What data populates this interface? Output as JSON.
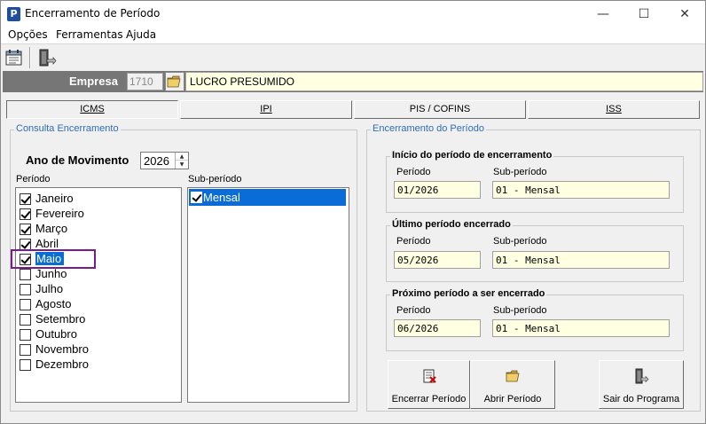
{
  "window": {
    "title": "Encerramento de Período",
    "icon_letter": "P",
    "minimize_glyph": "—",
    "maximize_glyph": "☐",
    "close_glyph": "✕"
  },
  "menu": [
    "Opções",
    "Ferramentas",
    "Ajuda"
  ],
  "empresa": {
    "label": "Empresa",
    "code": "1710",
    "name": "LUCRO PRESUMIDO"
  },
  "tabs": [
    "ICMS",
    "IPI",
    "PIS / COFINS",
    "ISS"
  ],
  "consulta": {
    "title": "Consulta Encerramento",
    "ano_label": "Ano de Movimento",
    "ano_value": "2026",
    "periodo_label": "Período",
    "subperiodo_label": "Sub-período",
    "months": [
      {
        "label": "Janeiro",
        "checked": true
      },
      {
        "label": "Fevereiro",
        "checked": true
      },
      {
        "label": "Março",
        "checked": true
      },
      {
        "label": "Abril",
        "checked": true
      },
      {
        "label": "Maio",
        "checked": true
      },
      {
        "label": "Junho",
        "checked": false
      },
      {
        "label": "Julho",
        "checked": false
      },
      {
        "label": "Agosto",
        "checked": false
      },
      {
        "label": "Setembro",
        "checked": false
      },
      {
        "label": "Outubro",
        "checked": false
      },
      {
        "label": "Novembro",
        "checked": false
      },
      {
        "label": "Dezembro",
        "checked": false
      }
    ],
    "subperiods": [
      {
        "label": "Mensal",
        "checked": true
      }
    ]
  },
  "encerramento": {
    "title": "Encerramento do Período",
    "periodo_label": "Período",
    "subperiodo_label": "Sub-período",
    "inicio": {
      "title": "Início do período de encerramento",
      "periodo": "01/2026",
      "subperiodo": "01 - Mensal"
    },
    "ultimo": {
      "title": "Último período encerrado",
      "periodo": "05/2026",
      "subperiodo": "01 - Mensal"
    },
    "proximo": {
      "title": "Próximo período a ser encerrado",
      "periodo": "06/2026",
      "subperiodo": "01 - Mensal"
    }
  },
  "buttons": {
    "encerrar": "Encerrar Período",
    "abrir": "Abrir Período",
    "sair": "Sair do Programa"
  },
  "colors": {
    "selection": "#0a6dd7",
    "highlight_border": "#7a1a8c",
    "field_bg": "#ffffe1",
    "group_title": "#2e6db5"
  }
}
